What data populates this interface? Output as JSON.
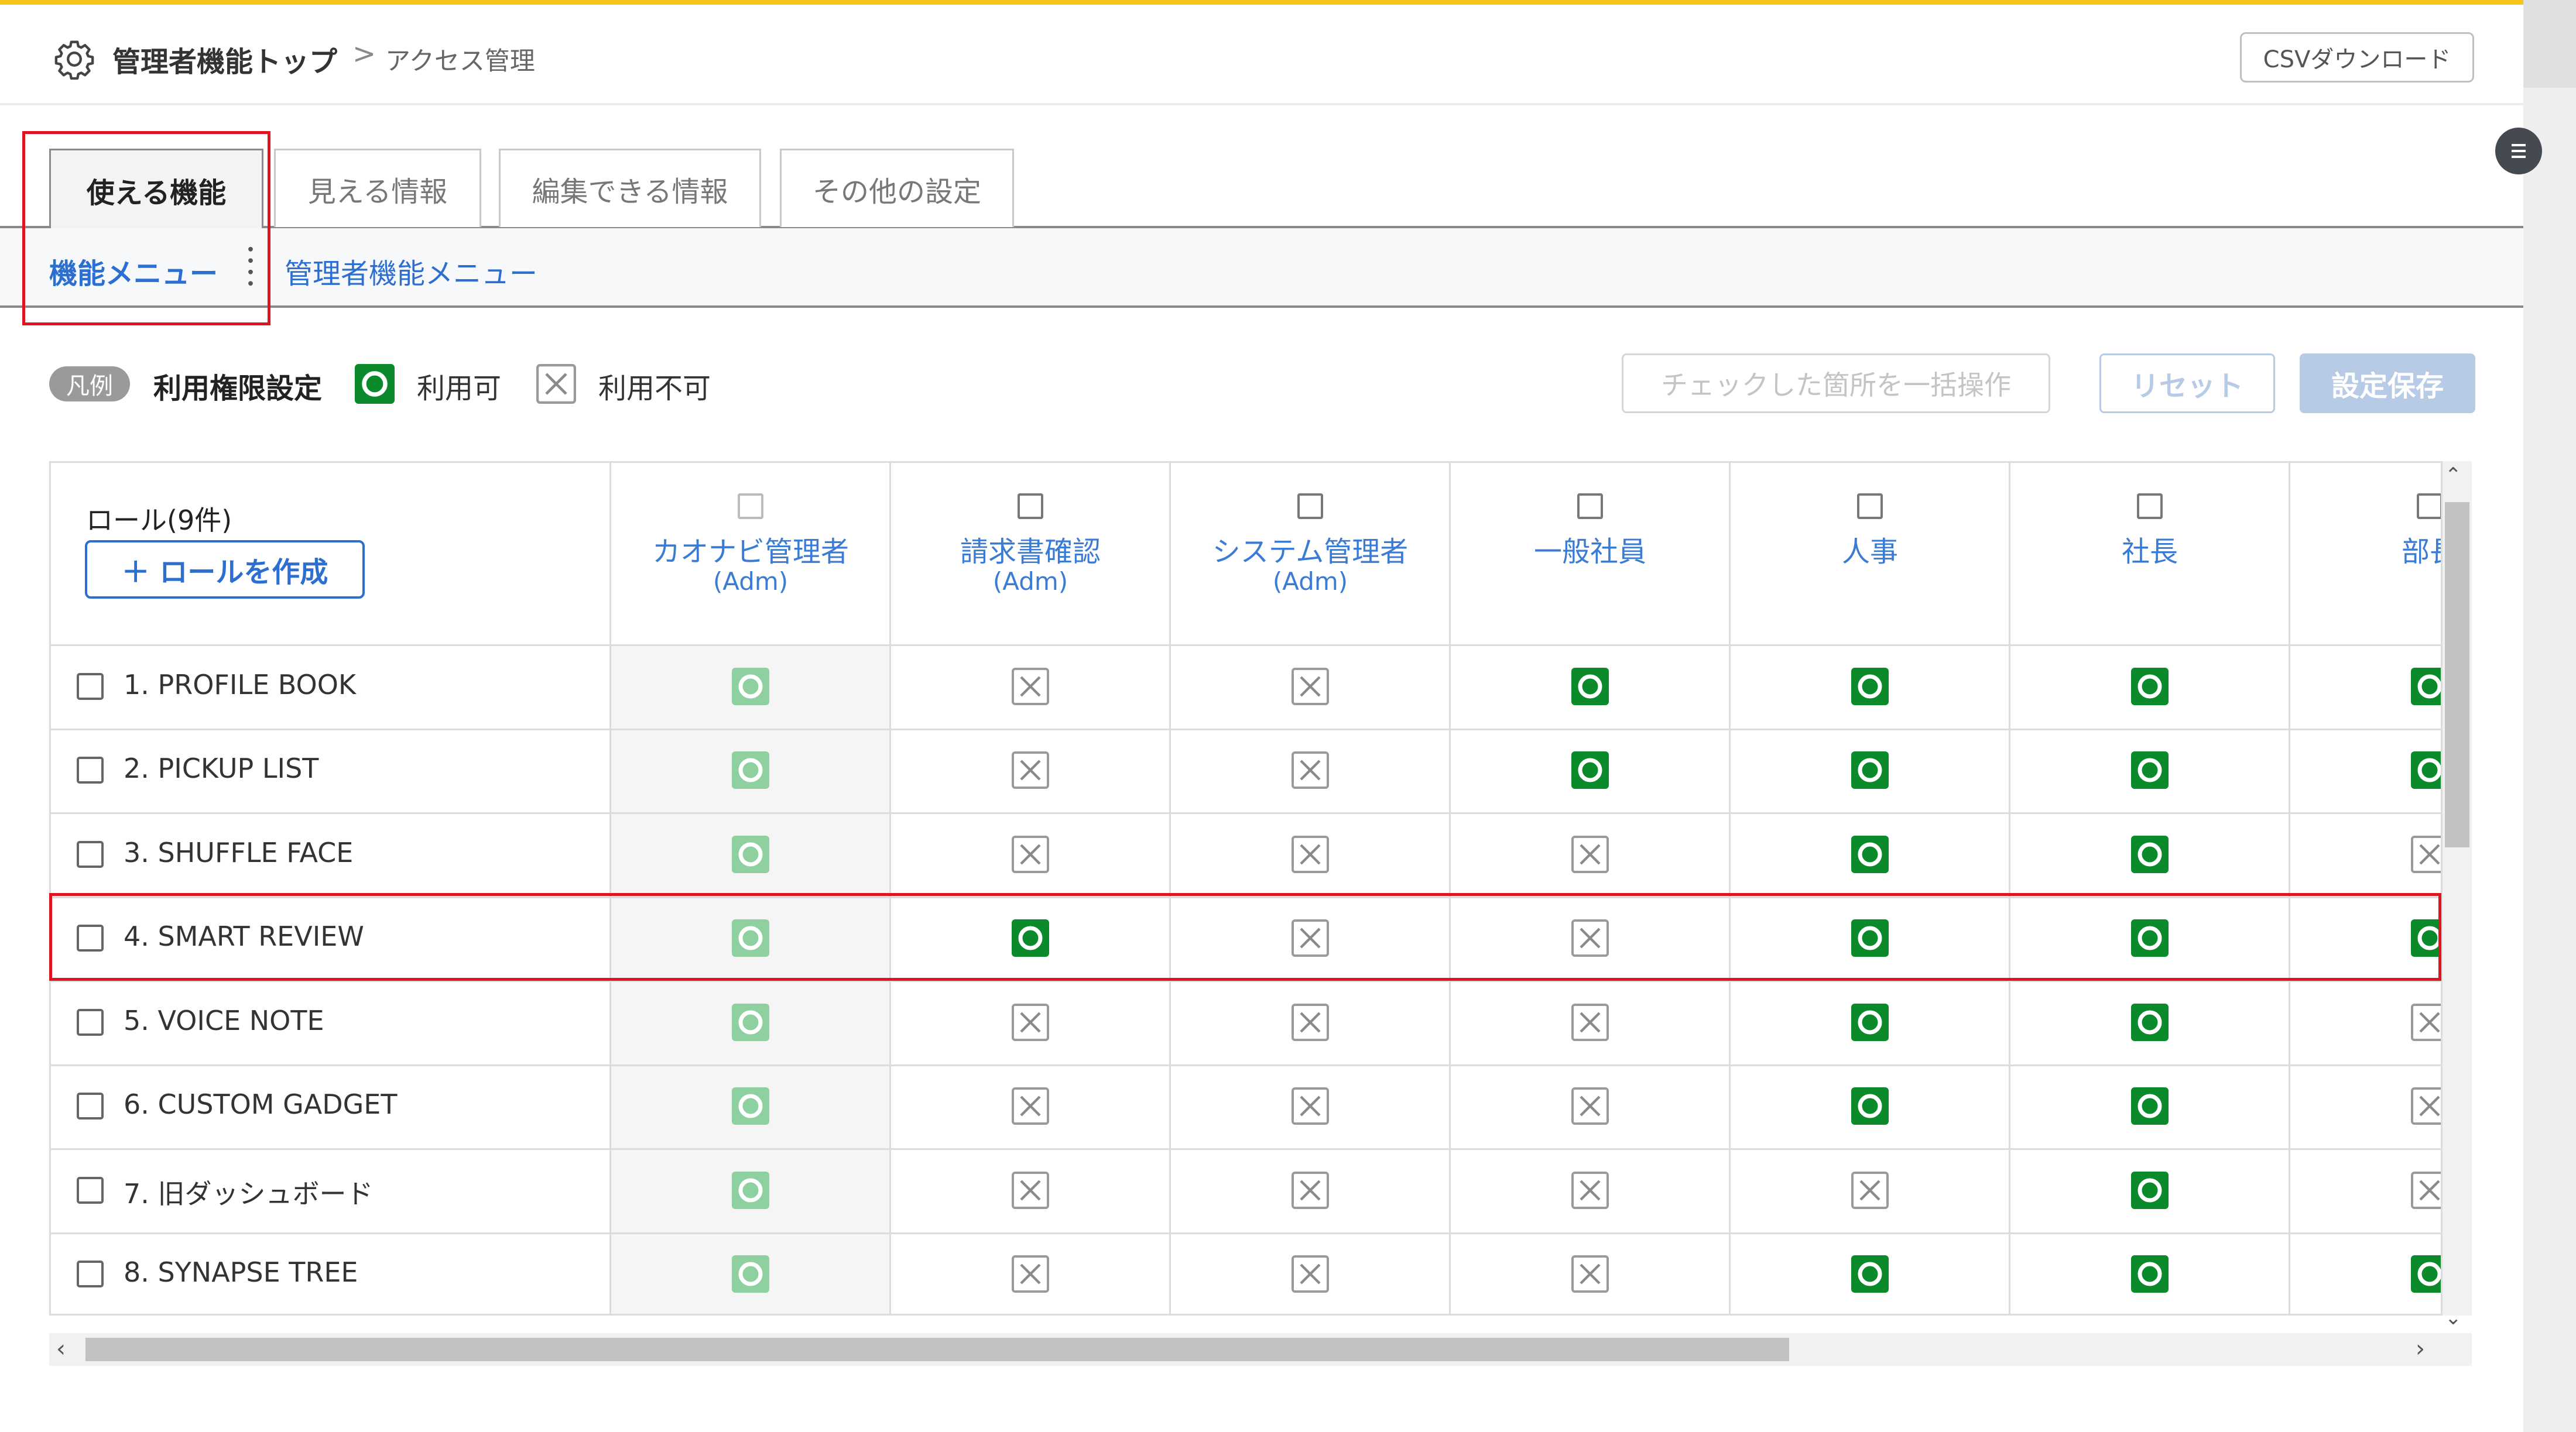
{
  "header": {
    "top_label": "管理者機能トップ",
    "separator": ">",
    "current": "アクセス管理",
    "csv_button": "CSVダウンロード"
  },
  "tabs": [
    {
      "label": "使える機能",
      "active": true
    },
    {
      "label": "見える情報",
      "active": false
    },
    {
      "label": "編集できる情報",
      "active": false
    },
    {
      "label": "その他の設定",
      "active": false
    }
  ],
  "subnav": [
    {
      "label": "機能メニュー",
      "active": true
    },
    {
      "label": "管理者機能メニュー",
      "active": false
    }
  ],
  "legend": {
    "pill": "凡例",
    "title": "利用権限設定",
    "ok_label": "利用可",
    "ng_label": "利用不可"
  },
  "actions": {
    "bulk": "チェックした箇所を一括操作",
    "reset": "リセット",
    "save": "設定保存"
  },
  "table": {
    "role_header": "ロール(9件)",
    "create_role": "＋ ロールを作成",
    "columns": [
      {
        "name": "カオナビ管理者",
        "sub": "(Adm)",
        "admin_light": true
      },
      {
        "name": "請求書確認",
        "sub": "(Adm)",
        "admin_light": false
      },
      {
        "name": "システム管理者",
        "sub": "(Adm)",
        "admin_light": false
      },
      {
        "name": "一般社員",
        "sub": "",
        "admin_light": false
      },
      {
        "name": "人事",
        "sub": "",
        "admin_light": false
      },
      {
        "name": "社長",
        "sub": "",
        "admin_light": false
      },
      {
        "name": "部長",
        "sub": "",
        "admin_light": false
      }
    ],
    "rows": [
      {
        "label": "1. PROFILE BOOK",
        "values": [
          "ok-light",
          "ng",
          "ng",
          "ok",
          "ok",
          "ok",
          "ok"
        ]
      },
      {
        "label": "2. PICKUP LIST",
        "values": [
          "ok-light",
          "ng",
          "ng",
          "ok",
          "ok",
          "ok",
          "ok"
        ]
      },
      {
        "label": "3. SHUFFLE FACE",
        "values": [
          "ok-light",
          "ng",
          "ng",
          "ng",
          "ok",
          "ok",
          "ng"
        ]
      },
      {
        "label": "4. SMART REVIEW",
        "values": [
          "ok-light",
          "ok",
          "ng",
          "ng",
          "ok",
          "ok",
          "ok"
        ]
      },
      {
        "label": "5. VOICE NOTE",
        "values": [
          "ok-light",
          "ng",
          "ng",
          "ng",
          "ok",
          "ok",
          "ng"
        ]
      },
      {
        "label": "6. CUSTOM GADGET",
        "values": [
          "ok-light",
          "ng",
          "ng",
          "ng",
          "ok",
          "ok",
          "ng"
        ]
      },
      {
        "label": "7. 旧ダッシュボード",
        "values": [
          "ok-light",
          "ng",
          "ng",
          "ng",
          "ng",
          "ok",
          "ng"
        ]
      },
      {
        "label": "8. SYNAPSE TREE",
        "values": [
          "ok-light",
          "ng",
          "ng",
          "ng",
          "ok",
          "ok",
          "ok"
        ]
      }
    ]
  },
  "colors": {
    "ok": "#0a8a2a",
    "ok_light": "#8fd0a0",
    "ng": "#9a9a9a",
    "accent": "#2d6fd0",
    "highlight": "#e0141e",
    "top_bar": "#f5c518"
  },
  "icons": {
    "settings": "gear-icon",
    "menu": "hamburger-icon"
  }
}
